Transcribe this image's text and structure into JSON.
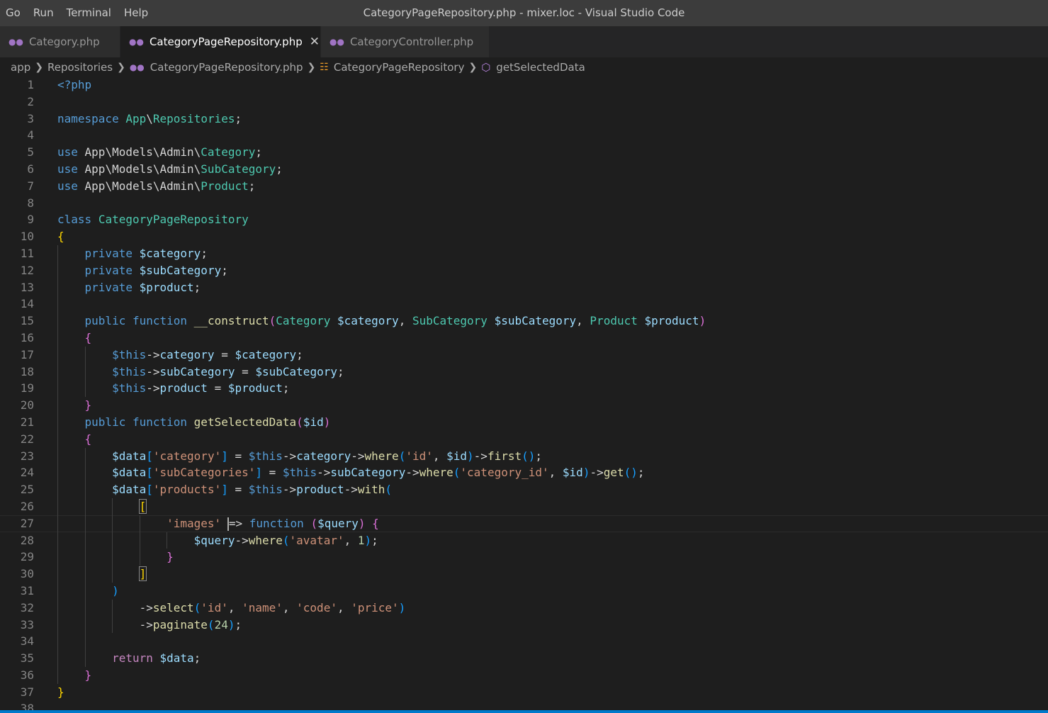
{
  "menu": {
    "items": [
      "Go",
      "Run",
      "Terminal",
      "Help"
    ]
  },
  "window_title": "CategoryPageRepository.php - mixer.loc - Visual Studio Code",
  "tabs": [
    {
      "label": "Category.php",
      "icon": "php-elephant-icon",
      "active": false
    },
    {
      "label": "CategoryPageRepository.php",
      "icon": "php-elephant-icon",
      "active": true
    },
    {
      "label": "CategoryController.php",
      "icon": "php-elephant-icon",
      "active": false
    }
  ],
  "breadcrumb": {
    "folder1": "app",
    "folder2": "Repositories",
    "file": "CategoryPageRepository.php",
    "class": "CategoryPageRepository",
    "method": "getSelectedData"
  },
  "editor": {
    "current_line": 27,
    "lines": [
      "<?php",
      "",
      "namespace App\\Repositories;",
      "",
      "use App\\Models\\Admin\\Category;",
      "use App\\Models\\Admin\\SubCategory;",
      "use App\\Models\\Admin\\Product;",
      "",
      "class CategoryPageRepository",
      "{",
      "    private $category;",
      "    private $subCategory;",
      "    private $product;",
      "",
      "    public function __construct(Category $category, SubCategory $subCategory, Product $product)",
      "    {",
      "        $this->category = $category;",
      "        $this->subCategory = $subCategory;",
      "        $this->product = $product;",
      "    }",
      "    public function getSelectedData($id)",
      "    {",
      "        $data['category'] = $this->category->where('id', $id)->first();",
      "        $data['subCategories'] = $this->subCategory->where('category_id', $id)->get();",
      "        $data['products'] = $this->product->with(",
      "            [",
      "                'images' => function ($query) {",
      "                    $query->where('avatar', 1);",
      "                }",
      "            ]",
      "        )",
      "            ->select('id', 'name', 'code', 'price')",
      "            ->paginate(24);",
      "",
      "        return $data;",
      "    }",
      "}",
      ""
    ]
  },
  "colors": {
    "accent": "#007acc",
    "keyword": "#569cd6",
    "class_name": "#4ec9b0",
    "variable": "#9cdcfe",
    "function": "#dcdcaa",
    "string": "#ce9178"
  }
}
